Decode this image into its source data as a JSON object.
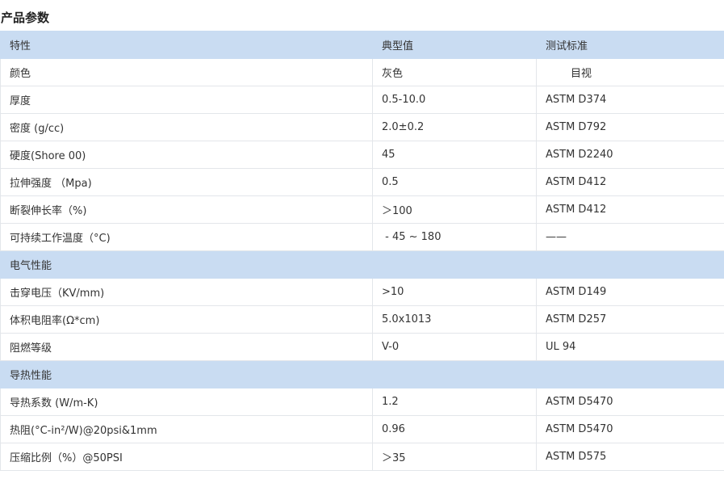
{
  "title": "产品参数",
  "header": {
    "col1": "特性",
    "col2": "典型值",
    "col3": "测试标准"
  },
  "rows": [
    {
      "property": "颜色",
      "value": "灰色",
      "standard": "目视"
    },
    {
      "property": "厚度",
      "value": "0.5-10.0",
      "standard": "ASTM D374"
    },
    {
      "property": "密度 (g/cc)",
      "value": "2.0±0.2",
      "standard": "ASTM D792"
    },
    {
      "property": "硬度(Shore 00)",
      "value": "45",
      "standard": "ASTM D2240"
    },
    {
      "property": "拉伸强度 （Mpa)",
      "value": "0.5",
      "standard": "ASTM D412"
    },
    {
      "property": "断裂伸长率（%)",
      "value": "＞100",
      "standard": "ASTM D412"
    },
    {
      "property": "可持续工作温度（°C)",
      "value": " - 45 ~ 180",
      "standard": "——"
    }
  ],
  "section_electrical": "电气性能",
  "electrical_rows": [
    {
      "property": "击穿电压（KV/mm)",
      "value": ">10",
      "standard": "ASTM D149"
    },
    {
      "property": "体积电阻率(Ω*cm)",
      "value": "5.0x1013",
      "standard": "ASTM D257"
    },
    {
      "property": "阻燃等级",
      "value": "V-0",
      "standard": "UL 94"
    }
  ],
  "section_thermal": "导热性能",
  "thermal_rows": [
    {
      "property": "导热系数 (W/m-K)",
      "value": "1.2",
      "standard": "ASTM D5470"
    },
    {
      "property": "热阻(°C-in²/W)@20psi&1mm",
      "value": "0.96",
      "standard": "ASTM D5470"
    },
    {
      "property": "压缩比例（%）@50PSI",
      "value": "＞35",
      "standard": "ASTM D575"
    }
  ]
}
